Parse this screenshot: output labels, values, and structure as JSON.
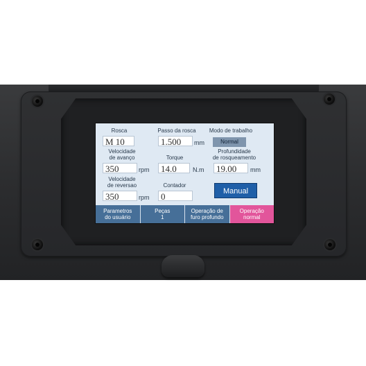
{
  "screen": {
    "rosca": {
      "label": "Rosca",
      "value": "M 10"
    },
    "passo": {
      "label": "Passo da rosca",
      "value": "1.500",
      "unit": "mm"
    },
    "modo": {
      "label": "Modo de trabalho",
      "value": "Normal"
    },
    "vel_avanco": {
      "label_line1": "Velocidade",
      "label_line2": "de avanço",
      "value": "350",
      "unit": "rpm"
    },
    "torque": {
      "label": "Torque",
      "value": "14.0",
      "unit": "N.m"
    },
    "profundidade": {
      "label_line1": "Profundidade",
      "label_line2": "de rosqueamento",
      "value": "19.00",
      "unit": "mm"
    },
    "vel_reversao": {
      "label_line1": "Velocidade",
      "label_line2": "de reversao",
      "value": "350",
      "unit": "rpm"
    },
    "contador": {
      "label": "Contador",
      "value": "0"
    },
    "manual_button": "Manual",
    "tabs": [
      {
        "line1": "Parametros",
        "line2": "do usuário",
        "active": false
      },
      {
        "line1": "Peças",
        "line2": "1",
        "active": false
      },
      {
        "line1": "Operação de",
        "line2": "furo profundo",
        "active": false
      },
      {
        "line1": "Operação",
        "line2": "normal",
        "active": true
      }
    ]
  },
  "colors": {
    "screen_bg": "#dfe9f3",
    "tab_bg": "#466f98",
    "tab_active": "#e2559b",
    "manual_button": "#1f5fa8",
    "mode_box": "#7f95ad",
    "housing": "#2c2d2f"
  }
}
